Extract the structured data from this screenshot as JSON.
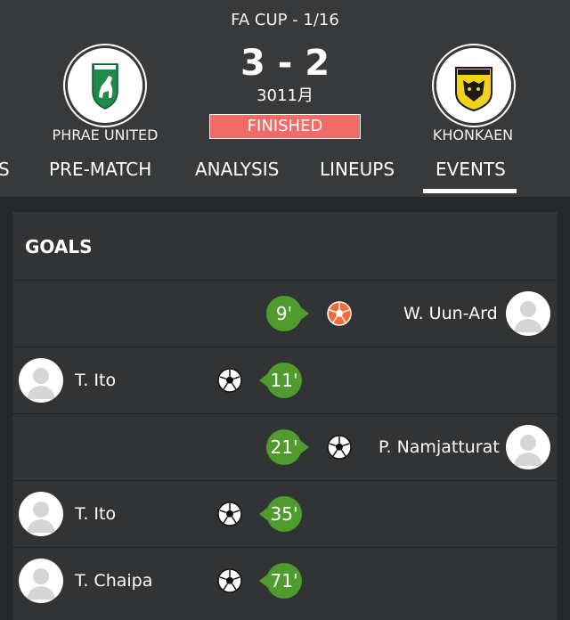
{
  "match": {
    "competition": "FA CUP - 1/16",
    "score": "3 - 2",
    "date": "3011月",
    "status": "FINISHED",
    "home_team": "PHRAE UNITED",
    "away_team": "KHONKAEN",
    "home_crest_text": "PHRAE UNITED",
    "away_crest_text": "KHONKAEN"
  },
  "tabs": [
    "S",
    "PRE-MATCH",
    "ANALYSIS",
    "LINEUPS",
    "EVENTS"
  ],
  "active_tab": "EVENTS",
  "goals": {
    "title": "GOALS",
    "events": [
      {
        "minute": "9'",
        "player": "W. Uun-Ard",
        "side": "away",
        "type": "own-goal"
      },
      {
        "minute": "11'",
        "player": "T. Ito",
        "side": "home",
        "type": "goal"
      },
      {
        "minute": "21'",
        "player": "P. Namjatturat",
        "side": "away",
        "type": "goal"
      },
      {
        "minute": "35'",
        "player": "T. Ito",
        "side": "home",
        "type": "goal"
      },
      {
        "minute": "71'",
        "player": "T. Chaipa",
        "side": "home",
        "type": "goal"
      }
    ]
  },
  "colors": {
    "header_bg": "#37393b",
    "card_bg": "#313335",
    "status_red": "#f26b67",
    "minute_green": "#4f9b2e",
    "own_goal_orange": "#f26b38"
  }
}
